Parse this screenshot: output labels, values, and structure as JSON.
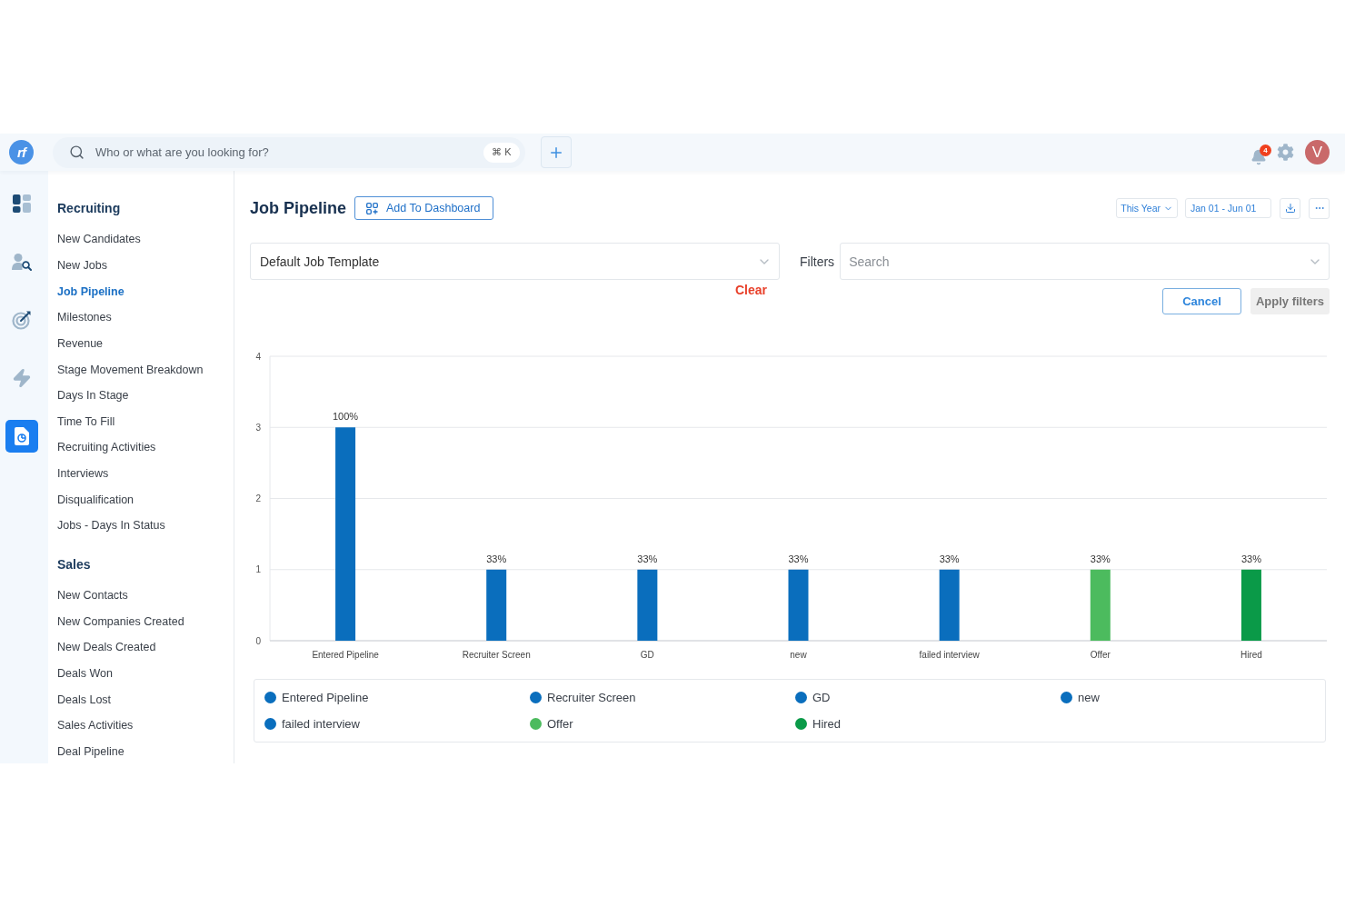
{
  "topbar": {
    "logo": "rf",
    "search": {
      "placeholder": "Who or what are you looking for?",
      "shortcut": "⌘ K"
    },
    "notifications": {
      "count": "4"
    },
    "avatar": {
      "initial": "V"
    }
  },
  "rail": [
    {
      "kind": "dashboard",
      "selected": false
    },
    {
      "kind": "people",
      "selected": false
    },
    {
      "kind": "goals",
      "selected": false
    },
    {
      "kind": "automation",
      "selected": false
    },
    {
      "kind": "reports",
      "selected": true
    }
  ],
  "nav": {
    "sections": [
      {
        "title": "Recruiting",
        "items": [
          {
            "label": "New Candidates",
            "selected": false
          },
          {
            "label": "New Jobs",
            "selected": false
          },
          {
            "label": "Job Pipeline",
            "selected": true
          },
          {
            "label": "Milestones",
            "selected": false
          },
          {
            "label": "Revenue",
            "selected": false
          },
          {
            "label": "Stage Movement Breakdown",
            "selected": false
          },
          {
            "label": "Days In Stage",
            "selected": false
          },
          {
            "label": "Time To Fill",
            "selected": false
          },
          {
            "label": "Recruiting Activities",
            "selected": false
          },
          {
            "label": "Interviews",
            "selected": false
          },
          {
            "label": "Disqualification",
            "selected": false
          },
          {
            "label": "Jobs - Days In Status",
            "selected": false
          }
        ]
      },
      {
        "title": "Sales",
        "items": [
          {
            "label": "New Contacts",
            "selected": false
          },
          {
            "label": "New Companies Created",
            "selected": false
          },
          {
            "label": "New Deals Created",
            "selected": false
          },
          {
            "label": "Deals Won",
            "selected": false
          },
          {
            "label": "Deals Lost",
            "selected": false
          },
          {
            "label": "Sales Activities",
            "selected": false
          },
          {
            "label": "Deal Pipeline",
            "selected": false
          }
        ]
      }
    ]
  },
  "header": {
    "title": "Job Pipeline",
    "add_button": "Add To Dashboard",
    "period": "This Year",
    "date_range": "Jan 01 - Jun 01"
  },
  "template_select": {
    "value": "Default Job Template",
    "clear": "Clear"
  },
  "filters": {
    "label": "Filters",
    "placeholder": "Search",
    "cancel": "Cancel",
    "apply": {
      "label": "Apply filters",
      "disabled": true
    }
  },
  "chart": {
    "chart_data": {
      "type": "bar",
      "categories": [
        "Entered Pipeline",
        "Recruiter Screen",
        "GD",
        "new",
        "failed interview",
        "Offer",
        "Hired"
      ],
      "values": [
        3,
        1,
        1,
        1,
        1,
        1,
        1
      ],
      "ylim": [
        0,
        4
      ],
      "yticks": [
        0,
        1,
        2,
        3,
        4
      ],
      "grid": true,
      "annotations": [
        {
          "y": 3,
          "text": "100%"
        },
        {
          "y": 1,
          "text": "33%"
        },
        {
          "y": 1,
          "text": "33%"
        },
        {
          "y": 1,
          "text": "33%"
        },
        {
          "y": 1,
          "text": "33%"
        },
        {
          "y": 1,
          "text": "33%"
        },
        {
          "y": 1,
          "text": "33%"
        }
      ]
    },
    "legend": [
      {
        "label": "Entered Pipeline",
        "color": "#0a6ebd"
      },
      {
        "label": "Recruiter Screen",
        "color": "#0a6ebd"
      },
      {
        "label": "GD",
        "color": "#0a6ebd"
      },
      {
        "label": "new",
        "color": "#0a6ebd"
      },
      {
        "label": "failed interview",
        "color": "#0a6ebd"
      },
      {
        "label": "Offer",
        "color": "#4cbb5e"
      },
      {
        "label": "Hired",
        "color": "#0a9a48"
      }
    ]
  }
}
